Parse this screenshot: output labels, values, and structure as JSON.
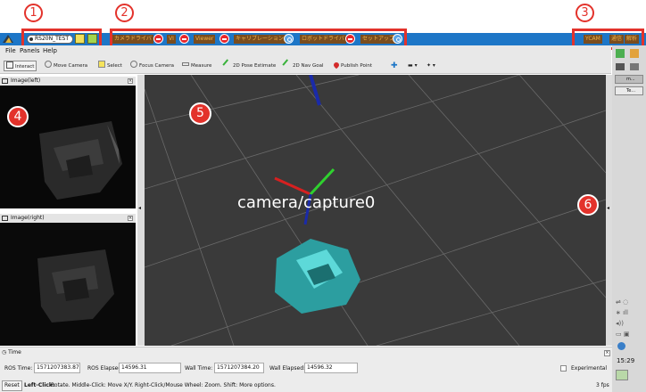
{
  "callouts": {
    "one": "1",
    "two": "2",
    "three": "3",
    "four": "4",
    "five": "5",
    "six": "6"
  },
  "launcher": {
    "config_name": "RS20N_TEST",
    "items": [
      {
        "label": "カメラドライバ",
        "state": "stop"
      },
      {
        "label": "VI",
        "state": "stop"
      },
      {
        "label": "Viewer",
        "state": "stop"
      },
      {
        "label": "キャリブレーション",
        "state": "play"
      },
      {
        "label": "ロボットドライバ",
        "state": "stop"
      },
      {
        "label": "セットアップ",
        "state": "play"
      }
    ],
    "right_buttons": [
      "YCAM",
      "通信",
      "解析"
    ]
  },
  "menu": {
    "file": "File",
    "panels": "Panels",
    "help": "Help"
  },
  "tools": [
    "Interact",
    "Move Camera",
    "Select",
    "Focus Camera",
    "Measure",
    "2D Pose Estimate",
    "2D Nav Goal",
    "Publish Point"
  ],
  "image_left": {
    "title": "Image(left)"
  },
  "image_right": {
    "title": "Image(right)"
  },
  "viewer": {
    "frame_label": "camera/capture0"
  },
  "side_panel": {
    "tab1": "m...",
    "tab2": "Te...",
    "clock": "15:29"
  },
  "time": {
    "section_title": "Time",
    "ros_time_label": "ROS Time:",
    "ros_time": "1571207383.87",
    "ros_elapsed_label": "ROS Elapsed:",
    "ros_elapsed": "14596.31",
    "wall_time_label": "Wall Time:",
    "wall_time": "1571207384.20",
    "wall_elapsed_label": "Wall Elapsed:",
    "wall_elapsed": "14596.32",
    "experimental": "Experimental"
  },
  "status": {
    "reset": "Reset",
    "hint_lead": "Left-Click:",
    "hint_body": "Rotate. Middle-Click: Move X/Y. Right-Click/Mouse Wheel: Zoom. Shift: More options.",
    "fps": "3 fps"
  },
  "colors": {
    "accent": "#1d76c7",
    "callout": "#e3322b",
    "launch_text": "#f0b247",
    "pointcloud": "#3fc9c9"
  }
}
